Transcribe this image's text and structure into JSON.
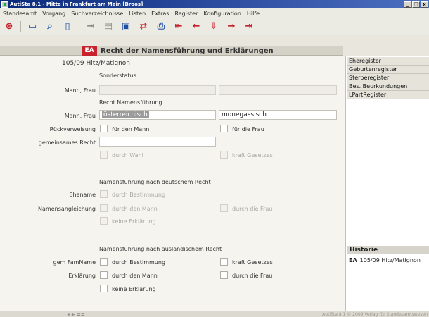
{
  "window": {
    "title": "AutiSta 8.1 - Mitte in Frankfurt am Main [Broos]",
    "buttons": [
      "_",
      "□",
      "x"
    ]
  },
  "menu": [
    "Standesamt",
    "Vorgang",
    "Suchverzeichnisse",
    "Listen",
    "Extras",
    "Register",
    "Konfiguration",
    "Hilfe"
  ],
  "toolbar": {
    "icons": [
      "new-record-icon",
      "open-folder-icon",
      "search-icon",
      "document-icon",
      "export-icon",
      "documents-icon",
      "clipboard-icon",
      "exchange-icon",
      "print-icon",
      "first-record-icon",
      "previous-record-icon",
      "jump-icon",
      "next-record-icon",
      "last-record-icon"
    ]
  },
  "header": {
    "badge": "EA",
    "title": "Recht der Namensführung und Erklärungen"
  },
  "form": {
    "record": "105/09 Hitz/Matignon",
    "sonderstatus": "Sonderstatus",
    "mann_frau_label": "Mann, Frau",
    "recht_namensfuehrung": "Recht Namensführung",
    "mann_frau_label2": "Mann, Frau",
    "value_mann": "österreichisch",
    "value_frau": "monegassisch",
    "rueckverweisung_label": "Rückverweisung",
    "fuer_den_mann": "für den Mann",
    "fuer_die_frau": "für die Frau",
    "gemeinsames_recht_label": "gemeinsames Recht",
    "durch_wahl": "durch Wahl",
    "kraft_gesetzes": "kraft Gesetzes",
    "deutsches_recht_heading": "Namensführung nach deutschem Recht",
    "ehename_label": "Ehename",
    "durch_bestimmung": "durch Bestimmung",
    "namensangleichung_label": "Namensangleichung",
    "durch_den_mann": "durch den Mann",
    "durch_die_frau": "durch die Frau",
    "keine_erklaerung": "keine Erklärung",
    "auslaendisches_recht_heading": "Namensführung nach ausländischem Recht",
    "gem_famname_label": "gem FamName",
    "durch_bestimmung2": "durch Bestimmung",
    "kraft_gesetzes2": "kraft Gesetzes",
    "erklaerung_label": "Erklärung",
    "durch_den_mann2": "durch den Mann",
    "durch_die_frau2": "durch die Frau",
    "keine_erklaerung2": "keine Erklärung"
  },
  "sidebar": {
    "items": [
      "Eheregister",
      "Geburtenregister",
      "Sterberegister",
      "Bes. Beurkundungen",
      "LPartRegister"
    ],
    "historie_title": "Historie",
    "historie_badge": "EA",
    "historie_entry": "105/09 Hitz/Matignon"
  },
  "status": {
    "nav": "++ ==",
    "copyright": "AutiSta 8.1 © 2009 Verlag für Standesamtswesen"
  }
}
